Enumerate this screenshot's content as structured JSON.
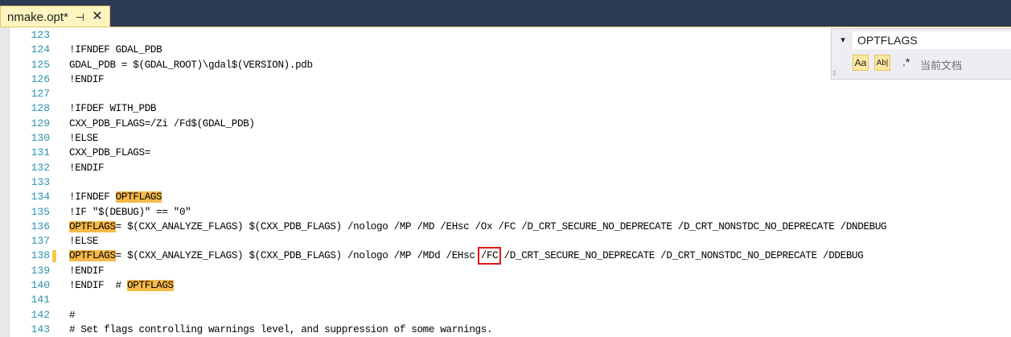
{
  "tab": {
    "title": "nmake.opt*",
    "pin_glyph": "⊣",
    "close_glyph": "✕"
  },
  "find": {
    "query": "OPTFLAGS",
    "chevron": "▾",
    "match_case_label": "Aa",
    "whole_word_label": "Ab|",
    "scope_icon": "regex-icon",
    "scope_label": "当前文档"
  },
  "editor": {
    "lines": [
      {
        "num": "123",
        "parts": []
      },
      {
        "num": "124",
        "parts": [
          {
            "t": "!IFNDEF GDAL_PDB"
          }
        ]
      },
      {
        "num": "125",
        "parts": [
          {
            "t": "GDAL_PDB = $(GDAL_ROOT)\\gdal$(VERSION).pdb"
          }
        ]
      },
      {
        "num": "126",
        "parts": [
          {
            "t": "!ENDIF"
          }
        ]
      },
      {
        "num": "127",
        "parts": []
      },
      {
        "num": "128",
        "parts": [
          {
            "t": "!IFDEF WITH_PDB"
          }
        ]
      },
      {
        "num": "129",
        "parts": [
          {
            "t": "CXX_PDB_FLAGS=/Zi /Fd$(GDAL_PDB)"
          }
        ]
      },
      {
        "num": "130",
        "parts": [
          {
            "t": "!ELSE"
          }
        ]
      },
      {
        "num": "131",
        "parts": [
          {
            "t": "CXX_PDB_FLAGS="
          }
        ]
      },
      {
        "num": "132",
        "parts": [
          {
            "t": "!ENDIF"
          }
        ]
      },
      {
        "num": "133",
        "parts": []
      },
      {
        "num": "134",
        "parts": [
          {
            "t": "!IFNDEF "
          },
          {
            "t": "OPTFLAGS",
            "hl": true
          }
        ]
      },
      {
        "num": "135",
        "parts": [
          {
            "t": "!IF \"$(DEBUG)\" == \"0\""
          }
        ]
      },
      {
        "num": "136",
        "parts": [
          {
            "t": "OPTFLAGS",
            "hl": true
          },
          {
            "t": "= $(CXX_ANALYZE_FLAGS) $(CXX_PDB_FLAGS) /nologo /MP /MD /EHsc /Ox /FC /D_CRT_SECURE_NO_DEPRECATE /D_CRT_NONSTDC_NO_DEPRECATE /DNDEBUG"
          }
        ]
      },
      {
        "num": "137",
        "parts": [
          {
            "t": "!ELSE"
          }
        ]
      },
      {
        "num": "138",
        "marker": true,
        "parts": [
          {
            "t": "OPTFLAGS",
            "hl": true
          },
          {
            "t": "= $(CXX_ANALYZE_FLAGS) $(CXX_PDB_FLAGS) /nologo /MP /MDd /EHsc "
          },
          {
            "t": "/FC",
            "box": true
          },
          {
            "t": " /D_CRT_SECURE_NO_DEPRECATE /D_CRT_NONSTDC_NO_DEPRECATE /DDEBUG"
          }
        ]
      },
      {
        "num": "139",
        "parts": [
          {
            "t": "!ENDIF"
          }
        ]
      },
      {
        "num": "140",
        "parts": [
          {
            "t": "!ENDIF  # "
          },
          {
            "t": "OPTFLAGS",
            "hl": true
          }
        ]
      },
      {
        "num": "141",
        "parts": []
      },
      {
        "num": "142",
        "parts": [
          {
            "t": "#"
          }
        ]
      },
      {
        "num": "143",
        "parts": [
          {
            "t": "# Set flags controlling warnings level, and suppression of some warnings."
          }
        ]
      }
    ]
  }
}
